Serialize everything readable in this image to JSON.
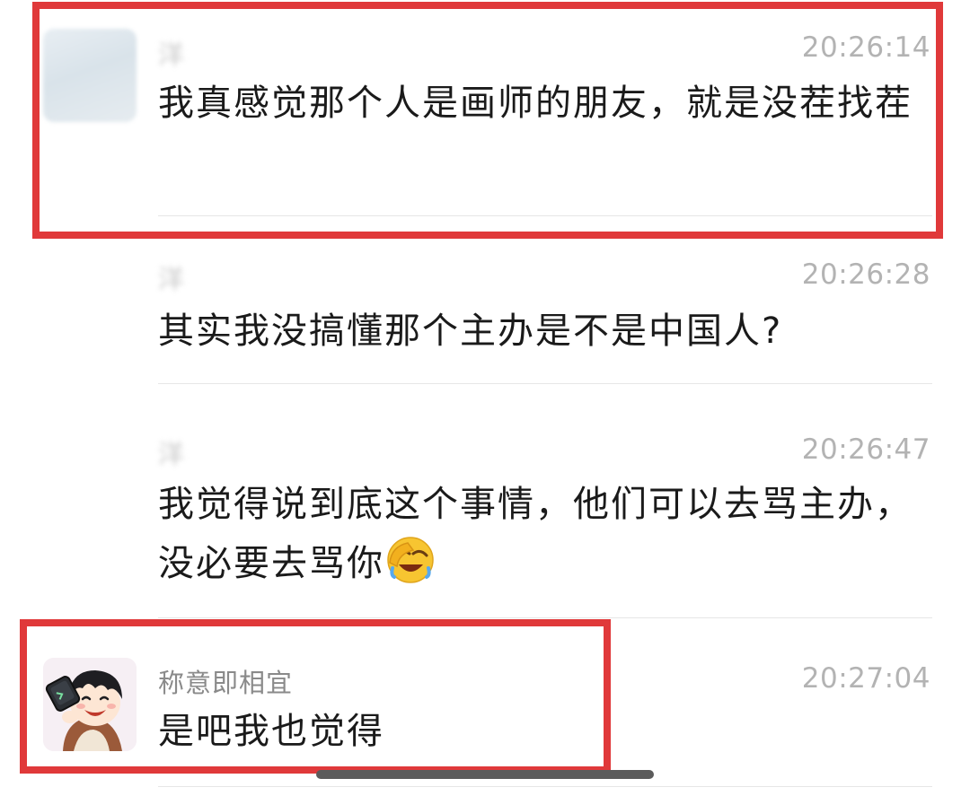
{
  "messages": [
    {
      "sender": "洋",
      "time": "20:26:14",
      "text": "我真感觉那个人是画师的朋友，就是没茬找茬"
    },
    {
      "sender": "洋",
      "time": "20:26:28",
      "text": "其实我没搞懂那个主办是不是中国人?"
    },
    {
      "sender": "洋",
      "time": "20:26:47",
      "text": "我觉得说到底这个事情，他们可以去骂主办，没必要去骂你"
    },
    {
      "sender": "称意即相宜",
      "time": "20:27:04",
      "text": "是吧我也觉得"
    }
  ],
  "icons": {
    "emoji": "facepalm-laughing-emoji"
  },
  "colors": {
    "highlight": "#e0393a",
    "time": "#b3b3b3",
    "text": "#1a1a1a"
  }
}
